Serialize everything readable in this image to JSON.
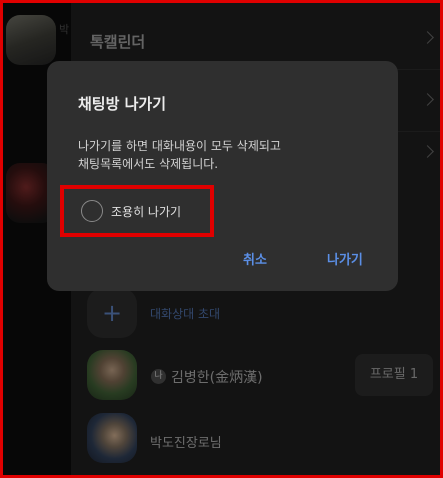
{
  "left": {
    "preview_text": "박"
  },
  "panel": {
    "menu_items": [
      {
        "label": "톡캘린더"
      }
    ],
    "invite_label": "대화상대 초대",
    "members": [
      {
        "badge": "나",
        "name": "김병한(金炳漢)",
        "profile_button": "프로필 1"
      },
      {
        "name": "박도진장로님"
      }
    ]
  },
  "dialog": {
    "title": "채팅방 나가기",
    "message": "나가기를 하면 대화내용이 모두 삭제되고\n채팅목록에서도 삭제됩니다.",
    "quiet_leave_label": "조용히 나가기",
    "cancel_label": "취소",
    "leave_label": "나가기"
  },
  "colors": {
    "highlight": "#e00000",
    "accent": "#5b8fe6",
    "dialog_bg": "#2f2f2f"
  }
}
